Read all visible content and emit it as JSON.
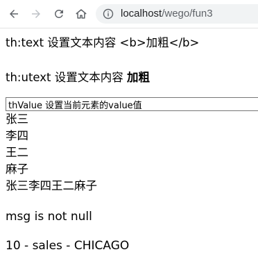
{
  "browser": {
    "url_host": "localhost",
    "url_path": "/wego/fun3",
    "icons": [
      "back-arrow-icon",
      "forward-arrow-icon",
      "reload-icon",
      "home-icon",
      "info-icon"
    ]
  },
  "page": {
    "text_line": "th:text 设置文本内容 <b>加粗</b>",
    "utext_prefix": "th:utext 设置文本内容 ",
    "utext_bold": "加粗",
    "input_value": "thValue 设置当前元素的value值",
    "names": [
      "张三",
      "李四",
      "王二",
      "麻子"
    ],
    "names_joined": "张三李四王二麻子",
    "msg": "msg is not null",
    "dept": "10 - sales - CHICAGO"
  }
}
